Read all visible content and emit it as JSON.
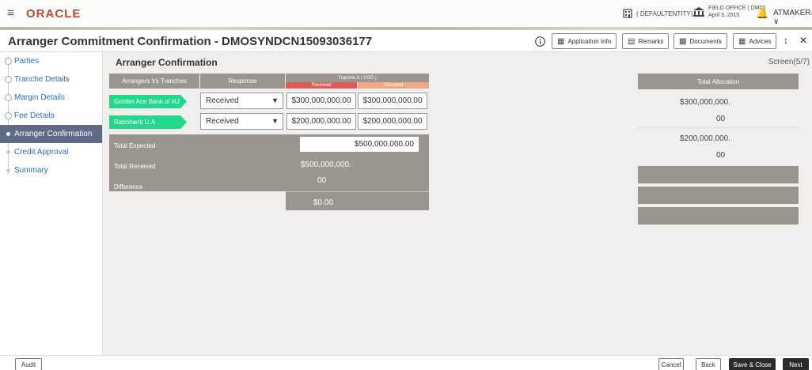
{
  "header": {
    "logo": "ORACLE",
    "entity": "( DEFAULTENTITY)",
    "office_name": "FIELD OFFICE ( DMO)",
    "office_date": "April 3, 2015",
    "user": "ATMAKER4"
  },
  "titlebar": {
    "title": "Arranger Commitment Confirmation - DMOSYNDCN15093036177",
    "buttons": [
      "Application Info",
      "Remarks",
      "Documents",
      "Advices"
    ]
  },
  "sidebar": {
    "items": [
      {
        "label": "Parties"
      },
      {
        "label": "Tranche Details"
      },
      {
        "label": "Margin Details"
      },
      {
        "label": "Fee Details"
      },
      {
        "label": "Arranger Confirmation"
      },
      {
        "label": "Credit Approval"
      },
      {
        "label": "Summary"
      }
    ],
    "active_index": 4
  },
  "main": {
    "section_title": "Arranger Confirmation",
    "screen": "Screen(5/7)",
    "col_arrangers": "Arrangers Vs Tranches",
    "col_response": "Response",
    "tranche_name": "Tranche A  ( USD )",
    "tranche_received": "Received",
    "tranche_allocated": "Allocated",
    "col_total_alloc": "Total Allocation",
    "rows": [
      {
        "arranger": "Golden Ace Bank of RJ",
        "response": "Received",
        "received": "$300,000,000.00",
        "allocated": "$300,000,000.00",
        "total_line1": "$300,000,000.",
        "total_line2": "00"
      },
      {
        "arranger": "Rabobank U.A",
        "response": "Received",
        "received": "$200,000,000.00",
        "allocated": "$200,000,000.00",
        "total_line1": "$200,000,000.",
        "total_line2": "00"
      }
    ],
    "total_expected_label": "Total Expected",
    "total_expected_value": "$500,000,000.00",
    "total_received_label": "Total Received",
    "total_received_line1": "$500,000,000.",
    "total_received_line2": "00",
    "difference_label": "Difference",
    "difference_value": "$0.00"
  },
  "footer": {
    "audit": "Audit",
    "cancel": "Cancel",
    "back": "Back",
    "save_close": "Save & Close",
    "next": "Next"
  },
  "colors": {
    "brand": "#c74634",
    "arranger_tag": "#23d88a",
    "grid_grey": "#9a968f",
    "active_nav": "#5e6a87"
  }
}
